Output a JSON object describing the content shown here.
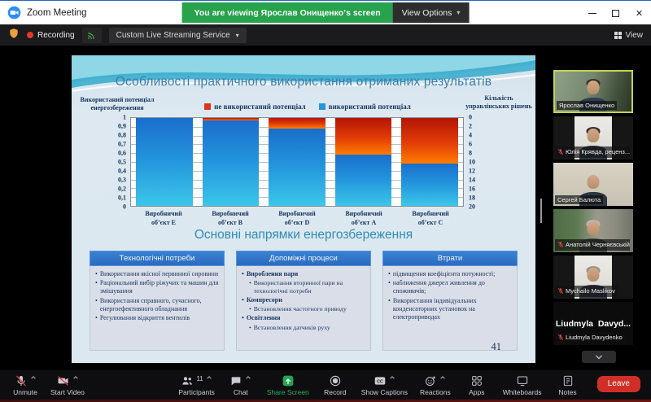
{
  "window": {
    "title": "Zoom Meeting",
    "viewing_banner": "You are viewing Ярослав Онищенко’s screen",
    "view_options_label": "View Options"
  },
  "meeting_bar": {
    "recording_label": "Recording",
    "streaming_label": "Custom Live Streaming Service",
    "view_label": "View"
  },
  "slide": {
    "title": "Особливості практичного використання отриманих результатів",
    "section_title": "Основні напрямки енергозбереження",
    "page_number": "41",
    "cards": [
      {
        "header": "Технологічні потреби",
        "items": [
          {
            "text": "Використання якісної первинної сировини",
            "level": 1,
            "bold": false
          },
          {
            "text": "Раціональний вибір ріжучих та машин для змішування",
            "level": 1,
            "bold": false
          },
          {
            "text": "Використання справного, сучасного, енергоефективного обладнання",
            "level": 1,
            "bold": false
          },
          {
            "text": "Регулювання відкриття вентилів",
            "level": 1,
            "bold": false
          }
        ]
      },
      {
        "header": "Допоміжні процеси",
        "items": [
          {
            "text": "Вироблення пари",
            "level": 1,
            "bold": true
          },
          {
            "text": "Використання вторинної пари на технологічні потреби",
            "level": 2,
            "bold": false
          },
          {
            "text": "Компресори",
            "level": 1,
            "bold": true
          },
          {
            "text": "Встановлення частотного приводу",
            "level": 2,
            "bold": false
          },
          {
            "text": "Освітлення",
            "level": 1,
            "bold": true
          },
          {
            "text": "Встановлення датчиків руху",
            "level": 2,
            "bold": false
          }
        ]
      },
      {
        "header": "Втрати",
        "items": [
          {
            "text": "підвищення коефіцієнта потужності;",
            "level": 1,
            "bold": false
          },
          {
            "text": "наближення джерел живлення до споживачів;",
            "level": 1,
            "bold": false
          },
          {
            "text": "Використання індивідуальних конденсаторних установок на електроприводах",
            "level": 1,
            "bold": false
          }
        ]
      }
    ]
  },
  "chart_data": {
    "type": "bar",
    "stacked": true,
    "grid": true,
    "legend_position": "top",
    "categories": [
      "Виробничий об’єкт E",
      "Виробничий об’єкт B",
      "Виробничий об’єкт D",
      "Виробничий об’єкт А",
      "Виробничий об’єкт C"
    ],
    "series": [
      {
        "name": "не використаний потенціал",
        "color": "#e0321c",
        "values": [
          0,
          0.03,
          0.12,
          0.42,
          0.52
        ]
      },
      {
        "name": "використаний потенціал",
        "color": "#2596da",
        "values": [
          1.0,
          0.97,
          0.88,
          0.58,
          0.48
        ]
      }
    ],
    "left_axis": {
      "label": "Використаний потенціал енергозбереження",
      "range": [
        0,
        1
      ],
      "ticks": [
        "1",
        "0,9",
        "0,8",
        "0,7",
        "0,6",
        "0,5",
        "0,4",
        "0,3",
        "0,2",
        "0,1",
        "0"
      ]
    },
    "right_axis": {
      "label": "Кількість управлінських рішень",
      "range": [
        0,
        20
      ],
      "reversed": true,
      "ticks": [
        "0",
        "2",
        "4",
        "6",
        "8",
        "10",
        "12",
        "14",
        "16",
        "18",
        "20"
      ]
    }
  },
  "participants": [
    {
      "name": "Ярослав Онищенко",
      "muted": false,
      "active_speaker": true,
      "video": "room"
    },
    {
      "name": "Юлія Крявда, реценз...",
      "muted": true,
      "active_speaker": false,
      "video": "portrait-dark"
    },
    {
      "name": "Сергей Балюта",
      "muted": false,
      "active_speaker": false,
      "video": "bald"
    },
    {
      "name": "Анатолій Черняєвській",
      "muted": true,
      "active_speaker": false,
      "video": "outdoor"
    },
    {
      "name": "Mychailo Maslikov",
      "muted": true,
      "active_speaker": false,
      "video": "portrait-gray"
    },
    {
      "name": "Liudmyla Davydenko",
      "muted": true,
      "active_speaker": false,
      "video": "text-only",
      "tile_text": "Liudmyla  Davyd..."
    }
  ],
  "toolbar": {
    "left": [
      {
        "label": "Unmute",
        "icon": "mic-muted-icon",
        "chevron": true
      },
      {
        "label": "Start Video",
        "icon": "video-muted-icon",
        "chevron": true
      }
    ],
    "center": [
      {
        "label": "Participants",
        "icon": "participants-icon",
        "badge": "11",
        "chevron": true
      },
      {
        "label": "Chat",
        "icon": "chat-icon",
        "chevron": true
      },
      {
        "label": "Share Screen",
        "icon": "share-screen-icon",
        "accent": true
      },
      {
        "label": "Record",
        "icon": "record-icon"
      },
      {
        "label": "Show Captions",
        "icon": "captions-icon",
        "chevron": true
      },
      {
        "label": "Reactions",
        "icon": "reactions-icon",
        "chevron": true
      },
      {
        "label": "Apps",
        "icon": "apps-icon"
      },
      {
        "label": "Whiteboards",
        "icon": "whiteboard-icon"
      },
      {
        "label": "Notes",
        "icon": "notes-icon"
      }
    ],
    "leave_label": "Leave"
  },
  "colors": {
    "banner_green": "#26a34c",
    "leave_red": "#cf2f27",
    "active_speaker_border": "#c5d34f",
    "bar_used_blue": "#2596da",
    "bar_unused_red": "#e0321c"
  }
}
